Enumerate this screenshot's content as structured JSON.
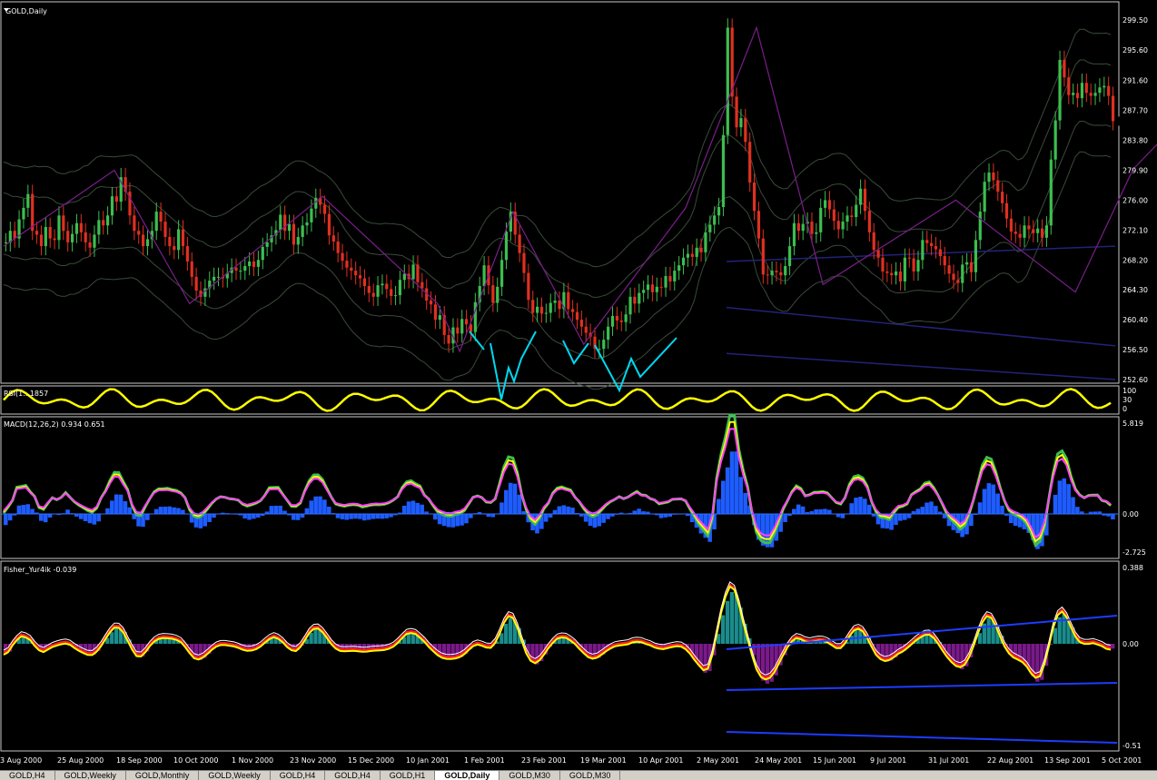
{
  "window": {
    "symbol_title": "GOLD,Daily"
  },
  "indicators": {
    "rsi_label": "RSI(1...1857",
    "rsi_levels": [
      "100",
      "30",
      "0"
    ],
    "macd_label": "MACD(12,26,2) 0.934 0.651",
    "macd_axis": [
      "5.819",
      "0.00",
      "-2.725"
    ],
    "fisher_label": "Fisher_Yur4ik -0.039",
    "fisher_axis": [
      "0.388",
      "0.00",
      "-0.51"
    ]
  },
  "price_axis": [
    "299.50",
    "295.60",
    "291.60",
    "287.70",
    "283.80",
    "279.90",
    "276.00",
    "272.10",
    "268.20",
    "264.30",
    "260.40",
    "256.50",
    "252.60"
  ],
  "date_axis": [
    "3 Aug 2000",
    "25 Aug 2000",
    "18 Sep 2000",
    "10 Oct 2000",
    "1 Nov 2000",
    "23 Nov 2000",
    "15 Dec 2000",
    "10 Jan 2001",
    "1 Feb 2001",
    "23 Feb 2001",
    "19 Mar 2001",
    "10 Apr 2001",
    "2 May 2001",
    "24 May 2001",
    "15 Jun 2001",
    "9 Jul 2001",
    "31 Jul 2001",
    "22 Aug 2001",
    "13 Sep 2001",
    "5 Oct 2001"
  ],
  "tabs": [
    "GOLD,H4",
    "GOLD,Weekly",
    "GOLD,Monthly",
    "GOLD,Weekly",
    "GOLD,H4",
    "GOLD,H4",
    "GOLD,H1",
    "GOLD,Daily",
    "GOLD,M30",
    "GOLD,M30"
  ],
  "active_tab": 7,
  "colors": {
    "bull": "#3cbe50",
    "bear": "#e03020",
    "zigzag": "#7a1f8a",
    "arrows": "#00d8f0",
    "rsi": "#ffff00",
    "macd_hist": "#1e5cff",
    "fisher_pos": "#1a8c8c",
    "fisher_neg": "#7a1a8a",
    "axis_text": "#ffffff"
  },
  "chart_data": {
    "type": "candlestick",
    "series_note": "",
    "closes": [
      270.5,
      272,
      271,
      273.5,
      275,
      276.8,
      272,
      271.5,
      270,
      272.5,
      271,
      270.8,
      274,
      272,
      270.5,
      271.6,
      273,
      271.8,
      270.5,
      269.8,
      271.5,
      273.4,
      272.7,
      274,
      276.5,
      275.8,
      279,
      277.1,
      274,
      272,
      271.5,
      270,
      270.9,
      272,
      274.5,
      273.2,
      271.2,
      270,
      269.5,
      272.2,
      270,
      268,
      266,
      264.2,
      263.4,
      264.5,
      265.5,
      266,
      266,
      265.8,
      266.5,
      267.2,
      266.8,
      266.8,
      267.4,
      268,
      267.3,
      268.2,
      269.9,
      270.5,
      271.4,
      272.1,
      274.1,
      272,
      272.9,
      270.2,
      271.2,
      272.7,
      273.1,
      274.9,
      276.3,
      275.4,
      274.2,
      271.4,
      270.6,
      269.1,
      268.1,
      267.2,
      266.8,
      266.2,
      265.8,
      264.8,
      263.9,
      263.4,
      264.9,
      265.1,
      264.4,
      263.5,
      263.6,
      265.6,
      266.4,
      265.7,
      267.6,
      265.3,
      264.5,
      262.9,
      262.4,
      260.4,
      261,
      258.4,
      257.3,
      259.4,
      258.6,
      260.5,
      259.8,
      258.8,
      262.7,
      264.8,
      267.5,
      264.9,
      262.6,
      264.7,
      268.2,
      271.9,
      274.5,
      271.5,
      269.1,
      266.5,
      263,
      261.3,
      262.1,
      261.2,
      261.3,
      262.6,
      262.9,
      261.8,
      264,
      261.8,
      261.4,
      260.4,
      259.5,
      258.7,
      258.2,
      256.6,
      256.6,
      257.8,
      259.5,
      260.9,
      260.3,
      260.1,
      261.1,
      263.4,
      262.5,
      263.9,
      264.3,
      265,
      264,
      264.7,
      264.6,
      266.1,
      265.4,
      266.8,
      267.5,
      268.5,
      269,
      268.6,
      269.8,
      269.2,
      271.8,
      272.8,
      274,
      275.1,
      284.5,
      298.5,
      289.5,
      285.5,
      286.7,
      283.6,
      278.3,
      274.6,
      271,
      266.3,
      266.2,
      266.8,
      266.6,
      266.2,
      267.4,
      270,
      273,
      272,
      272.9,
      273.2,
      271.6,
      271.8,
      275,
      276,
      274.8,
      273.3,
      272.2,
      273.2,
      274,
      273.8,
      275.4,
      277.5,
      274.6,
      271.8,
      269.5,
      268.5,
      266.7,
      266.5,
      266.2,
      266.7,
      265.4,
      268.5,
      268.4,
      266.7,
      268.2,
      270.8,
      270.4,
      270,
      269.6,
      268.7,
      267.5,
      266.4,
      265.6,
      265.2,
      267.6,
      267.9,
      266.6,
      270.8,
      274.5,
      278.4,
      279.6,
      278.6,
      277.1,
      275.6,
      273.6,
      271.9,
      271.6,
      271.1,
      272.7,
      272.2,
      271.7,
      272.3,
      271.1,
      272.7,
      281.3,
      286.4,
      294.3,
      292,
      289.7,
      290,
      289.3,
      291.3,
      290,
      289.6,
      290,
      290.7,
      290.9,
      289.6,
      286.3
    ]
  }
}
